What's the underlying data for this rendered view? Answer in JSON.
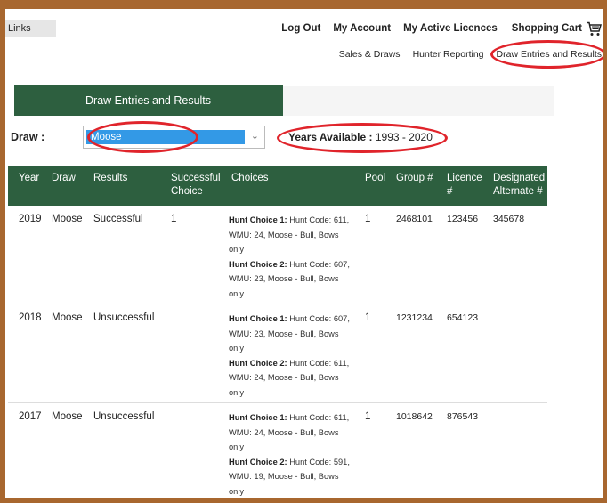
{
  "nav": {
    "links_tab": "Links",
    "top": [
      "Log Out",
      "My Account",
      "My Active Licences",
      "Shopping Cart"
    ],
    "sub": [
      "Sales & Draws",
      "Hunter Reporting",
      "Draw Entries and Results"
    ]
  },
  "section_title": "Draw Entries and Results",
  "draw": {
    "label": "Draw :",
    "selected": "Moose",
    "years_label": "Years Available :",
    "years_value": "1993 - 2020"
  },
  "table": {
    "headers": {
      "year": "Year",
      "draw": "Draw",
      "results": "Results",
      "successful_choice_1": "Successful",
      "successful_choice_2": "Choice",
      "choices": "Choices",
      "pool": "Pool",
      "group": "Group #",
      "licence_1": "Licence",
      "licence_2": "#",
      "alt_1": "Designated",
      "alt_2": "Alternate #"
    },
    "rows": [
      {
        "year": "2019",
        "draw": "Moose",
        "results": "Successful",
        "successful_choice": "1",
        "choice1_label": "Hunt Choice 1:",
        "choice1_text": "Hunt Code: 611, WMU: 24, Moose - Bull, Bows only",
        "choice2_label": "Hunt Choice 2:",
        "choice2_text": "Hunt Code: 607, WMU: 23, Moose - Bull, Bows only",
        "pool": "1",
        "group": "2468101",
        "licence": "123456",
        "alternate": "345678"
      },
      {
        "year": "2018",
        "draw": "Moose",
        "results": "Unsuccessful",
        "successful_choice": "",
        "choice1_label": "Hunt Choice 1:",
        "choice1_text": "Hunt Code: 607, WMU: 23, Moose - Bull, Bows only",
        "choice2_label": "Hunt Choice 2:",
        "choice2_text": "Hunt Code: 611, WMU: 24, Moose - Bull, Bows only",
        "pool": "1",
        "group": "1231234",
        "licence": "654123",
        "alternate": ""
      },
      {
        "year": "2017",
        "draw": "Moose",
        "results": "Unsuccessful",
        "successful_choice": "",
        "choice1_label": "Hunt Choice 1:",
        "choice1_text": "Hunt Code: 611, WMU: 24, Moose - Bull, Bows only",
        "choice2_label": "Hunt Choice 2:",
        "choice2_text": "Hunt Code: 591, WMU: 19, Moose - Bull, Bows only",
        "pool": "1",
        "group": "1018642",
        "licence": "876543",
        "alternate": ""
      }
    ]
  },
  "colors": {
    "frame": "#a8672f",
    "header_green": "#2d5f3f",
    "select_highlight": "#3399e6",
    "annotation_red": "#e0242b"
  }
}
